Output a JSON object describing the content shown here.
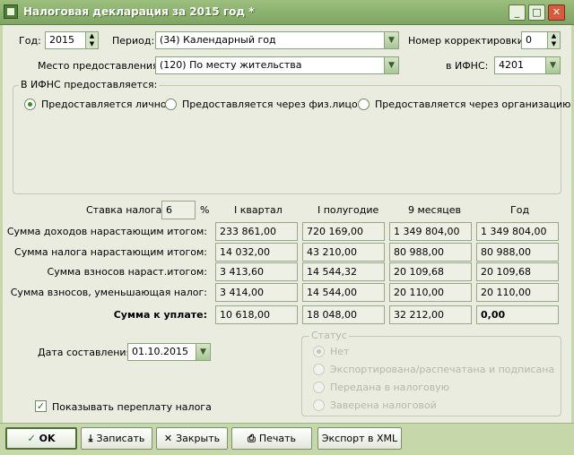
{
  "window": {
    "title": "Налоговая декларация за 2015 год *",
    "minimize": "_",
    "maximize": "□",
    "close": "✕"
  },
  "form": {
    "year_label": "Год:",
    "year_value": "2015",
    "period_label": "Период:",
    "period_value": "(34) Календарный год",
    "correction_label": "Номер корректировки:",
    "correction_value": "0",
    "place_label": "Место предоставления:",
    "place_value": "(120) По месту жительства",
    "ifns_label": "в ИФНС:",
    "ifns_value": "4201"
  },
  "ifns_group": {
    "title": "В ИФНС предоставляется:",
    "options": [
      "Предоставляется лично",
      "Предоставляется через физ.лицо",
      "Предоставляется через организацию"
    ],
    "selected_index": 0
  },
  "tax": {
    "rate_label": "Ставка налога:",
    "rate_value": "6",
    "rate_unit": "%",
    "columns": [
      "I квартал",
      "I полугодие",
      "9 месяцев",
      "Год"
    ],
    "rows": [
      {
        "label": "Сумма доходов нарастающим итогом:",
        "values": [
          "233 861,00",
          "720 169,00",
          "1 349 804,00",
          "1 349 804,00"
        ]
      },
      {
        "label": "Сумма налога нарастающим итогом:",
        "values": [
          "14 032,00",
          "43 210,00",
          "80 988,00",
          "80 988,00"
        ]
      },
      {
        "label": "Сумма взносов нараст.итогом:",
        "values": [
          "3 413,60",
          "14 544,32",
          "20 109,68",
          "20 109,68"
        ]
      },
      {
        "label": "Сумма взносов, уменьшающая налог:",
        "values": [
          "3 414,00",
          "14 544,00",
          "20 110,00",
          "20 110,00"
        ]
      },
      {
        "label": "Сумма к уплате:",
        "values": [
          "10 618,00",
          "18 048,00",
          "32 212,00",
          "0,00"
        ]
      }
    ]
  },
  "date": {
    "label": "Дата составления:",
    "value": "01.10.2015"
  },
  "status": {
    "title": "Статус",
    "options": [
      "Нет",
      "Экспортирована/распечатана и подписана",
      "Передана в налоговую",
      "Заверена налоговой"
    ],
    "selected_index": 0
  },
  "show_overpayment": {
    "label": "Показывать переплату налога",
    "checked": true
  },
  "buttons": {
    "ok": "OK",
    "save": "Записать",
    "close": "Закрыть",
    "print": "Печать",
    "export": "Экспорт в XML"
  },
  "icons": {
    "ok": "check-icon",
    "save": "save-arrow-icon",
    "close": "x-icon",
    "print": "printer-icon"
  }
}
